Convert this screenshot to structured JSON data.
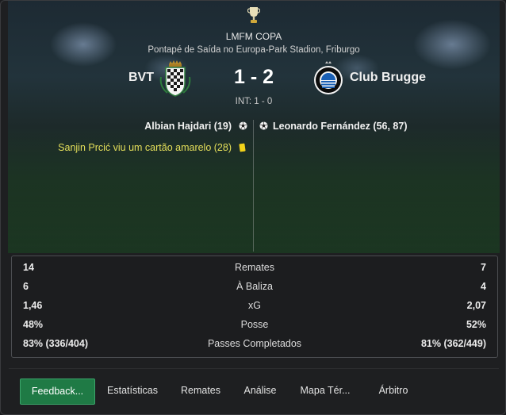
{
  "match": {
    "competition": "LMFM COPA",
    "venue": "Pontapé de Saída no Europa-Park Stadion, Friburgo",
    "home_team": "BVT",
    "away_team": "Club Brugge",
    "score": "1 - 2",
    "halftime": "INT: 1 - 0"
  },
  "events": {
    "home_goal": "Albian Hajdari (19)",
    "away_goal": "Leonardo Fernández (56, 87)",
    "home_card": "Sanjin Prcić viu um cartão amarelo (28)"
  },
  "stats": [
    {
      "home": "14",
      "label": "Remates",
      "away": "7"
    },
    {
      "home": "6",
      "label": "À Baliza",
      "away": "4"
    },
    {
      "home": "1,46",
      "label": "xG",
      "away": "2,07"
    },
    {
      "home": "48%",
      "label": "Posse",
      "away": "52%"
    },
    {
      "home": "83% (336/404)",
      "label": "Passes Completados",
      "away": "81% (362/449)"
    }
  ],
  "nav": {
    "feedback": "Feedback...",
    "statistics": "Estatísticas",
    "shots": "Remates",
    "analysis": "Análise",
    "map": "Mapa Tér...",
    "referee": "Árbitro"
  },
  "icons": {
    "trophy": "trophy-icon",
    "goal": "football-icon",
    "card": "yellow-card-icon"
  },
  "colors": {
    "accent_button": "#1f7a45",
    "card_text": "#e4df5a",
    "yellow_card": "#f2d21a"
  }
}
